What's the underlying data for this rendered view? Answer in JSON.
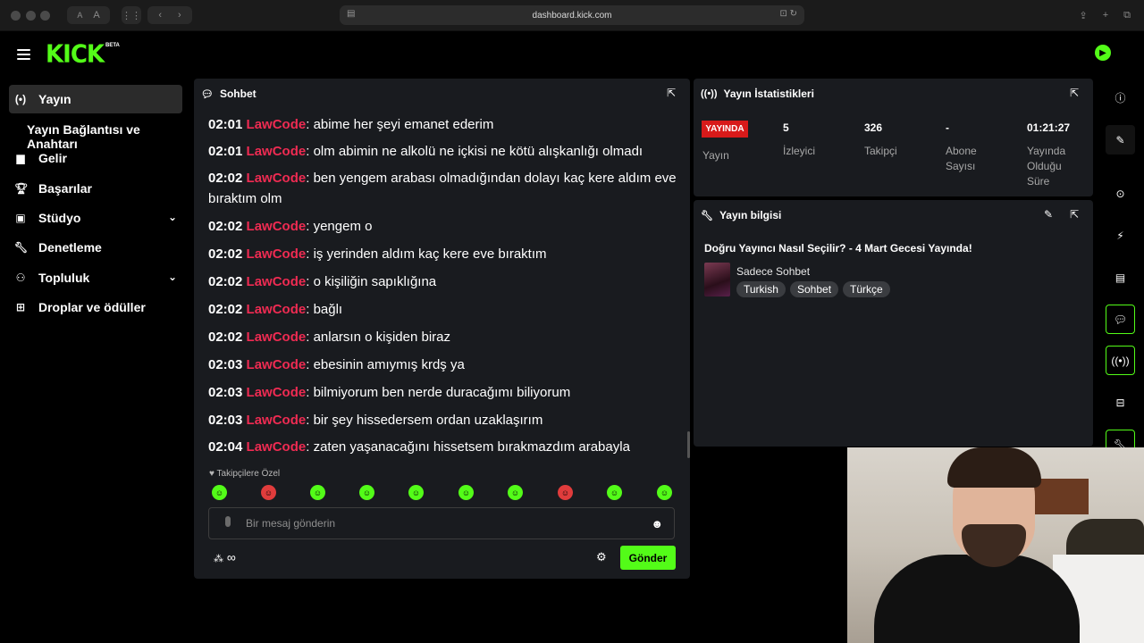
{
  "browser": {
    "url": "dashboard.kick.com",
    "text_size_small": "A",
    "text_size_large": "A"
  },
  "header": {
    "logo": "KICK",
    "logo_badge": "BETA"
  },
  "sidebar": {
    "items": [
      {
        "icon": "broadcast-icon",
        "label": "Yayın"
      },
      {
        "icon": "",
        "label": "Yayın Bağlantısı ve Anahtarı"
      },
      {
        "icon": "chart-icon",
        "label": "Gelir"
      },
      {
        "icon": "trophy-icon",
        "label": "Başarılar"
      },
      {
        "icon": "studio-icon",
        "label": "Stüdyo"
      },
      {
        "icon": "wrench-icon",
        "label": "Denetleme"
      },
      {
        "icon": "community-icon",
        "label": "Topluluk"
      },
      {
        "icon": "drops-icon",
        "label": "Droplar ve ödüller"
      }
    ]
  },
  "chat": {
    "title": "Sohbet",
    "messages": [
      {
        "time": "02:01",
        "user": "LawCode",
        "text": ": abime her şeyi emanet ederim"
      },
      {
        "time": "02:01",
        "user": "LawCode",
        "text": ": olm abimin ne alkolü ne içkisi ne kötü alışkanlığı olmadı"
      },
      {
        "time": "02:02",
        "user": "LawCode",
        "text": ": ben yengem arabası olmadığından dolayı kaç kere aldım eve bıraktım olm"
      },
      {
        "time": "02:02",
        "user": "LawCode",
        "text": ": yengem o"
      },
      {
        "time": "02:02",
        "user": "LawCode",
        "text": ": iş yerinden aldım kaç kere eve bıraktım"
      },
      {
        "time": "02:02",
        "user": "LawCode",
        "text": ": o kişiliğin sapıklığına"
      },
      {
        "time": "02:02",
        "user": "LawCode",
        "text": ": bağlı"
      },
      {
        "time": "02:02",
        "user": "LawCode",
        "text": ": anlarsın o kişiden biraz"
      },
      {
        "time": "02:03",
        "user": "LawCode",
        "text": ": ebesinin amıymış krdş ya"
      },
      {
        "time": "02:03",
        "user": "LawCode",
        "text": ": bilmiyorum ben nerde duracağımı biliyorum"
      },
      {
        "time": "02:03",
        "user": "LawCode",
        "text": ": bir şey hissedersem ordan uzaklaşırım"
      },
      {
        "time": "02:04",
        "user": "LawCode",
        "text": ": zaten yaşanacağını hissetsem bırakmazdım arabayla"
      }
    ],
    "followers_only": "Takipçilere Özel",
    "input_placeholder": "Bir mesaj gönderin",
    "send_label": "Gönder",
    "points": "∞"
  },
  "stats": {
    "title": "Yayın İstatistikleri",
    "live_badge": "YAYINDA",
    "live_label": "Yayın",
    "viewers_value": "5",
    "viewers_label": "İzleyici",
    "followers_value": "326",
    "followers_label": "Takipçi",
    "subs_value": "-",
    "subs_label": "Abone Sayısı",
    "uptime_value": "01:21:27",
    "uptime_label": "Yayında Olduğu Süre"
  },
  "info": {
    "title": "Yayın bilgisi",
    "stream_title": "Doğru Yayıncı Nasıl Seçilir? - 4 Mart Gecesi Yayında!",
    "category": "Sadece Sohbet",
    "tags": [
      "Turkish",
      "Sohbet",
      "Türkçe"
    ]
  },
  "colors": {
    "accent": "#53fc18",
    "username": "#ef2b52",
    "live": "#d81a1a",
    "panel": "#191b1f"
  }
}
